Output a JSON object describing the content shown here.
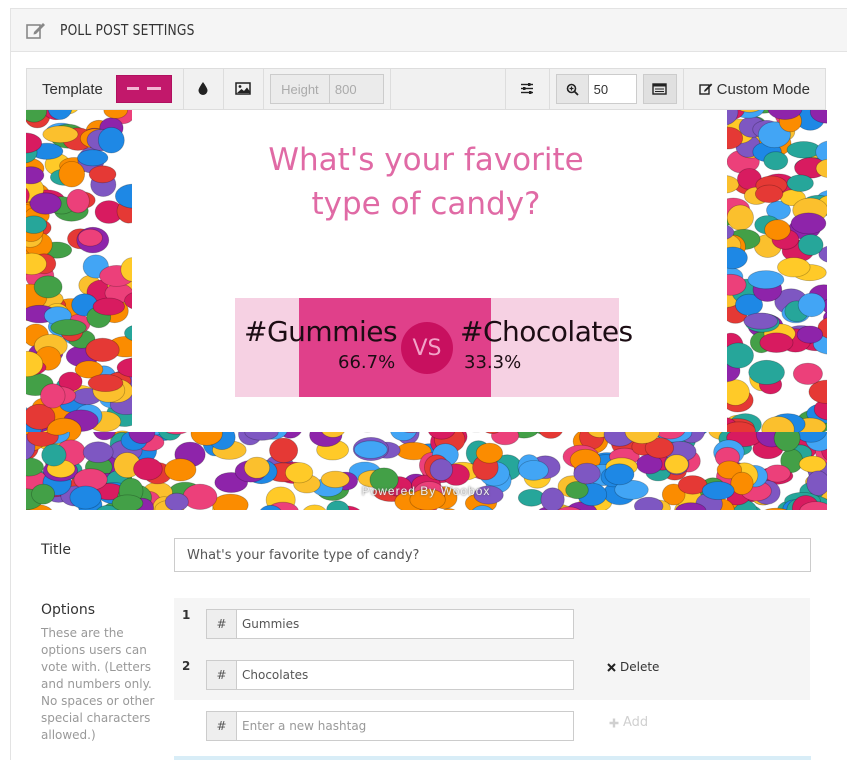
{
  "panel": {
    "title": "POLL POST SETTINGS",
    "icon": "edit-icon"
  },
  "toolbar": {
    "template_label": "Template",
    "color_icon": "droplet-icon",
    "image_icon": "image-icon",
    "height_label": "Height",
    "height_value": "800",
    "settings_icon": "sliders-icon",
    "zoom_icon": "zoom-in-icon",
    "zoom_value": "50",
    "layout_icon": "list-box-icon",
    "custom_mode_label": "Custom Mode"
  },
  "preview": {
    "question_line1": "What's your favorite",
    "question_line2": "type of candy?",
    "option_a": "#Gummies",
    "option_b": "#Chocolates",
    "percent_a": "66.7%",
    "percent_b": "33.3%",
    "share_a": 0.667,
    "share_b": 0.333,
    "vs": "VS",
    "powered_by": "Powered By Woobox",
    "accent_color": "#e06aa5",
    "bar_color": "#e0408a",
    "bar_bg_color": "#f6d1e3"
  },
  "form": {
    "title_label": "Title",
    "title_value": "What's your favorite type of candy?",
    "options_label": "Options",
    "options_help": "These are the options users can vote with. (Letters and numbers only. No spaces or other special characters allowed.)",
    "hash_symbol": "#",
    "options": [
      {
        "num": "1",
        "value": "Gummies"
      },
      {
        "num": "2",
        "value": "Chocolates"
      }
    ],
    "new_placeholder": "Enter a new hashtag",
    "delete_label": "Delete",
    "add_label": "Add"
  }
}
